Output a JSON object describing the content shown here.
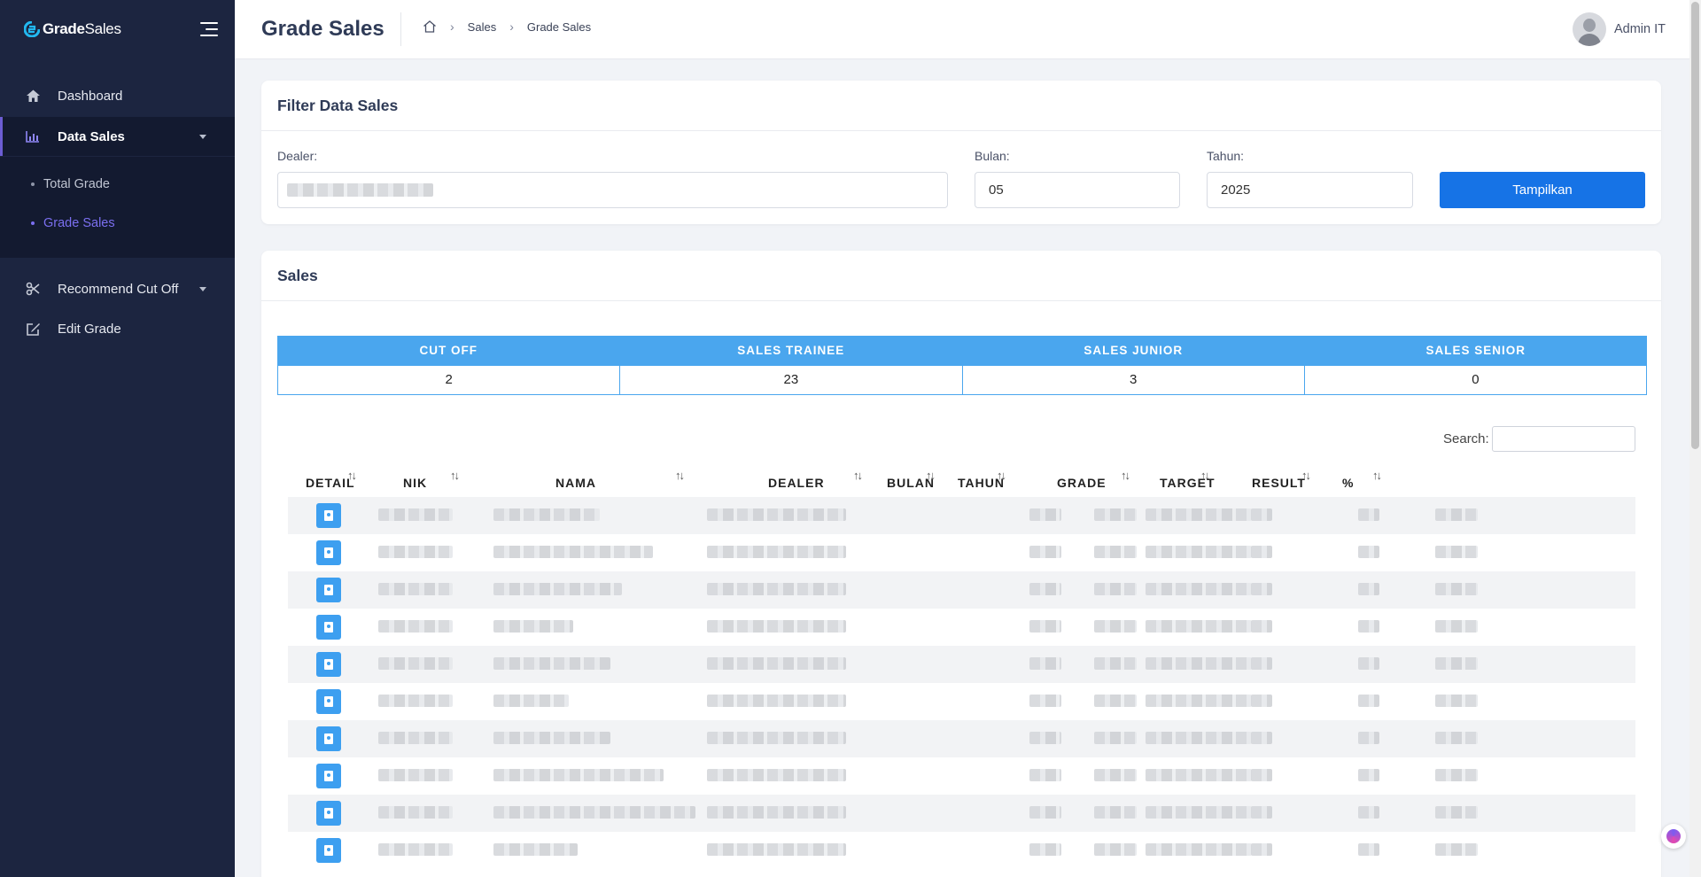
{
  "brand": {
    "name_bold": "Grade",
    "name_light": "Sales"
  },
  "sidebar": {
    "items": [
      {
        "label": "Dashboard",
        "icon": "home-icon"
      },
      {
        "label": "Data Sales",
        "icon": "bar-chart-icon"
      },
      {
        "label": "Recommend Cut Off",
        "icon": "scissors-icon"
      },
      {
        "label": "Edit Grade",
        "icon": "edit-icon"
      }
    ],
    "sub_items": [
      {
        "label": "Total Grade"
      },
      {
        "label": "Grade Sales"
      }
    ]
  },
  "header": {
    "title": "Grade Sales",
    "breadcrumb": [
      "Sales",
      "Grade Sales"
    ],
    "user_name": "Admin IT"
  },
  "filter": {
    "title": "Filter Data Sales",
    "dealer_label": "Dealer:",
    "bulan_label": "Bulan:",
    "bulan_value": "05",
    "tahun_label": "Tahun:",
    "tahun_value": "2025",
    "submit_label": "Tampilkan"
  },
  "sales": {
    "title": "Sales",
    "summary_headers": [
      "CUT OFF",
      "SALES TRAINEE",
      "SALES JUNIOR",
      "SALES SENIOR"
    ],
    "summary_values": [
      "2",
      "23",
      "3",
      "0"
    ],
    "search_label": "Search:",
    "columns": [
      "DETAIL",
      "NIK",
      "NAMA",
      "DEALER",
      "BULAN",
      "TAHUN",
      "GRADE",
      "TARGET",
      "RESULT",
      "%"
    ],
    "sort_glyph": "↑↓"
  },
  "colors": {
    "sidebar_bg": "#1c2540",
    "accent": "#6c5dd3",
    "primary_button": "#1673e6",
    "table_header": "#4aa6ee"
  }
}
